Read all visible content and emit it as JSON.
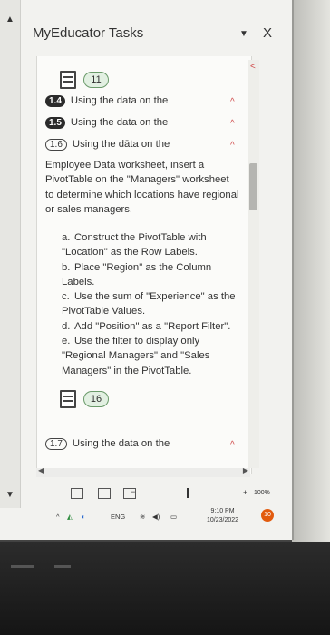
{
  "window": {
    "title": "MyEducator Tasks",
    "dropdown_icon": "chevron-down-icon",
    "close_label": "X"
  },
  "top_group": {
    "count": "11"
  },
  "tasks": [
    {
      "number": "1.4",
      "label": "Using the data on the"
    },
    {
      "number": "1.5",
      "label": "Using the data on the"
    },
    {
      "number": "1.6",
      "label": "Using the dāta on the"
    }
  ],
  "expanded": {
    "description": "Employee Data worksheet, insert a PivotTable on the \"Managers\" worksheet to determine which locations have regional or sales managers.",
    "steps": [
      {
        "label": "a.",
        "text": "Construct the PivotTable with \"Location\" as the Row Labels."
      },
      {
        "label": "b.",
        "text": "Place \"Region\" as the Column Labels."
      },
      {
        "label": "c.",
        "text": "Use the sum of \"Experience\" as the PivotTable Values."
      },
      {
        "label": "d.",
        "text": "Add \"Position\" as a \"Report Filter\"."
      },
      {
        "label": "e.",
        "text": "Use the filter to display only \"Regional Managers\" and \"Sales Managers\" in the PivotTable."
      }
    ]
  },
  "bottom_group": {
    "count": "16"
  },
  "task_last": {
    "number": "1.7",
    "label": "Using the data on the"
  },
  "status": {
    "zoom": "100%",
    "plus": "+"
  },
  "taskbar": {
    "language": "ENG",
    "time": "9:10 PM",
    "date": "10/23/2022",
    "notifications": "10"
  },
  "colors": {
    "accent_chevron": "#d04a4a",
    "badge_green": "#6a9a6a",
    "notif_orange": "#e25b0e"
  }
}
